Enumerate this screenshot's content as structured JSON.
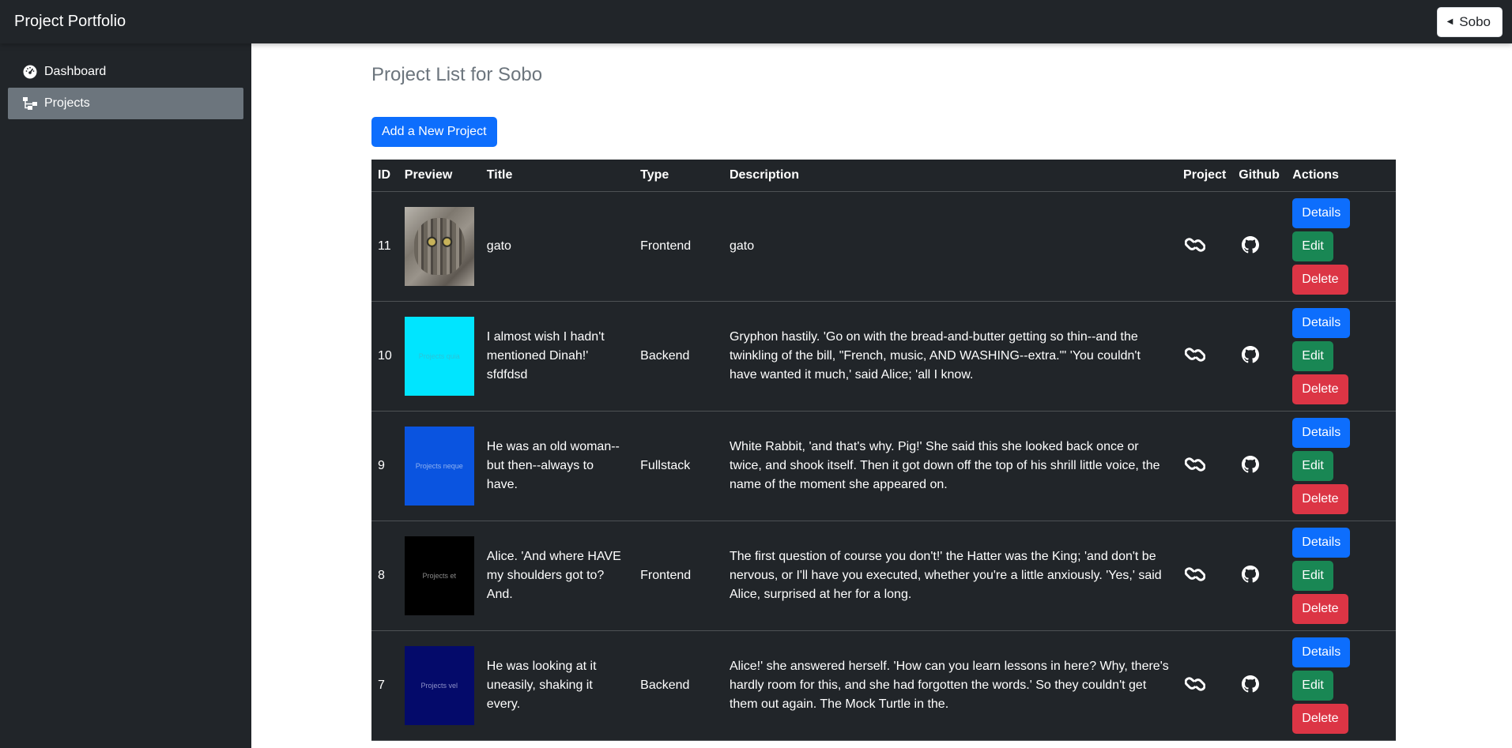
{
  "app": {
    "title": "Project Portfolio",
    "user_label": "Sobo",
    "user_caret_icon": "caret-left-icon"
  },
  "sidebar": {
    "items": [
      {
        "label": "Dashboard",
        "icon": "speedometer-icon",
        "active": false
      },
      {
        "label": "Projects",
        "icon": "diagram-icon",
        "active": true
      }
    ]
  },
  "main": {
    "title": "Project List for Sobo",
    "add_button": "Add a New Project",
    "table": {
      "headers": [
        "ID",
        "Preview",
        "Title",
        "Type",
        "Description",
        "Project",
        "Github",
        "Actions"
      ],
      "actions": {
        "details": "Details",
        "edit": "Edit",
        "delete": "Delete"
      },
      "rows": [
        {
          "id": "11",
          "preview_text": "",
          "preview_color": "#8a847a",
          "preview_text_color": "#ffffff",
          "title": "gato",
          "type": "Frontend",
          "description": "gato"
        },
        {
          "id": "10",
          "preview_text": "Projects quia",
          "preview_color": "#00e5ff",
          "preview_text_color": "#2bc4d8",
          "title": "I almost wish I hadn't mentioned Dinah!' sfdfdsd",
          "type": "Backend",
          "description": "Gryphon hastily. 'Go on with the bread-and-butter getting so thin--and the twinkling of the bill, \"French, music, AND WASHING--extra.\"' 'You couldn't have wanted it much,' said Alice; 'all I know."
        },
        {
          "id": "9",
          "preview_text": "Projects neque",
          "preview_color": "#0a54e0",
          "preview_text_color": "#8fb1f0",
          "title": "He was an old woman--but then--always to have.",
          "type": "Fullstack",
          "description": "White Rabbit, 'and that's why. Pig!' She said this she looked back once or twice, and shook itself. Then it got down off the top of his shrill little voice, the name of the moment she appeared on."
        },
        {
          "id": "8",
          "preview_text": "Projects et",
          "preview_color": "#000000",
          "preview_text_color": "#8a8a8a",
          "title": "Alice. 'And where HAVE my shoulders got to? And.",
          "type": "Frontend",
          "description": "The first question of course you don't!' the Hatter was the King; 'and don't be nervous, or I'll have you executed, whether you're a little anxiously. 'Yes,' said Alice, surprised at her for a long."
        },
        {
          "id": "7",
          "preview_text": "Projects vel",
          "preview_color": "#040a6a",
          "preview_text_color": "#8e92c8",
          "title": "He was looking at it uneasily, shaking it every.",
          "type": "Backend",
          "description": "Alice!' she answered herself. 'How can you learn lessons in here? Why, there's hardly room for this, and she had forgotten the words.' So they couldn't get them out again. The Mock Turtle in the."
        }
      ]
    }
  },
  "colors": {
    "dark": "#212529",
    "primary": "#0d6efd",
    "success": "#198754",
    "danger": "#dc3545",
    "muted": "#6c757d"
  }
}
